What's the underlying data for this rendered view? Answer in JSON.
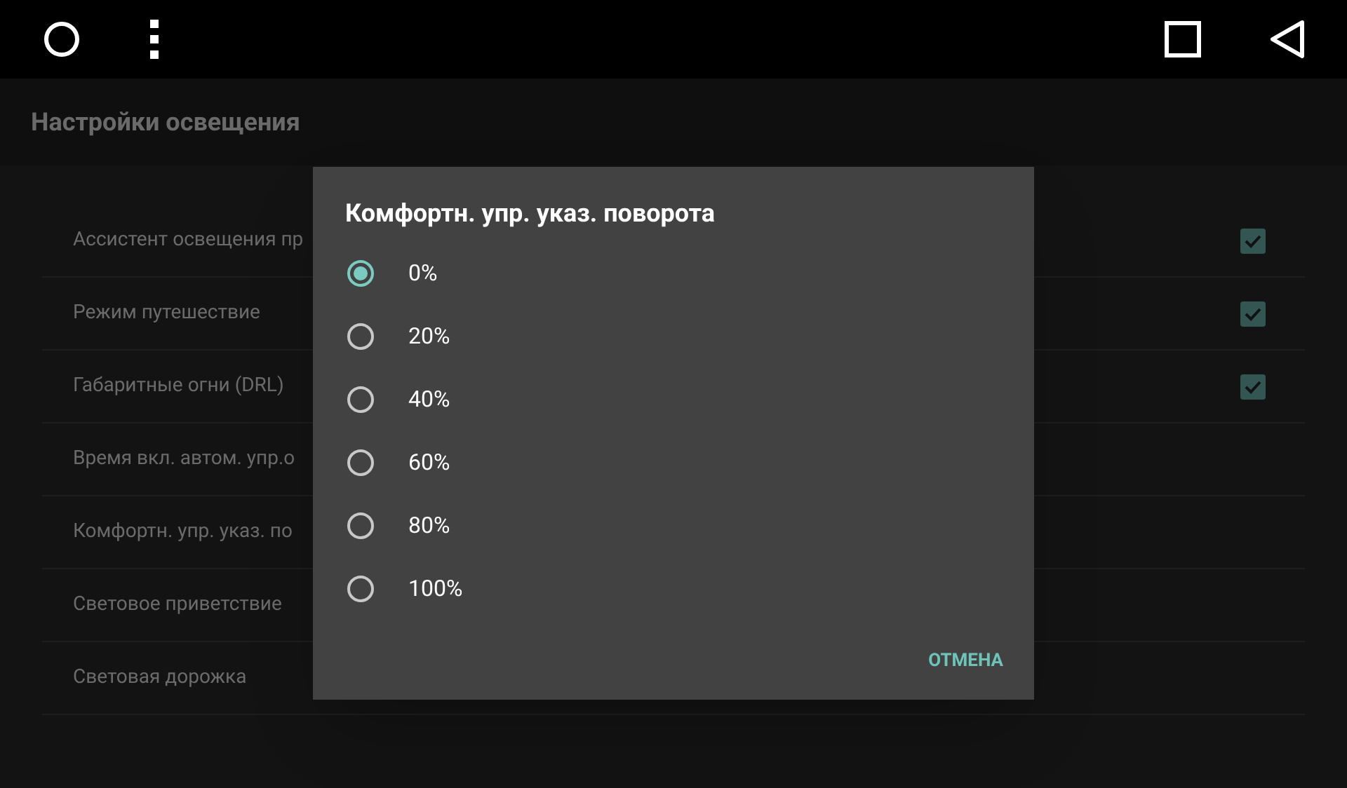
{
  "header": {
    "title": "Настройки освещения"
  },
  "settings": [
    {
      "label": "Ассистент освещения пр",
      "kind": "checkbox",
      "checked": true
    },
    {
      "label": "Режим путешествие",
      "kind": "checkbox",
      "checked": true
    },
    {
      "label": "Габаритные огни (DRL)",
      "kind": "checkbox",
      "checked": true
    },
    {
      "label": "Время вкл. автом. упр.о",
      "kind": "plain"
    },
    {
      "label": "Комфортн. упр. указ. по",
      "kind": "plain"
    },
    {
      "label": "Световое приветствие",
      "kind": "plain"
    },
    {
      "label": "Световая дорожка",
      "kind": "plain"
    }
  ],
  "dialog": {
    "title": "Комфортн. упр. указ. поворота",
    "options": [
      {
        "label": "0%",
        "selected": true
      },
      {
        "label": "20%",
        "selected": false
      },
      {
        "label": "40%",
        "selected": false
      },
      {
        "label": "60%",
        "selected": false
      },
      {
        "label": "80%",
        "selected": false
      },
      {
        "label": "100%",
        "selected": false
      }
    ],
    "cancel": "ОТМЕНА"
  }
}
